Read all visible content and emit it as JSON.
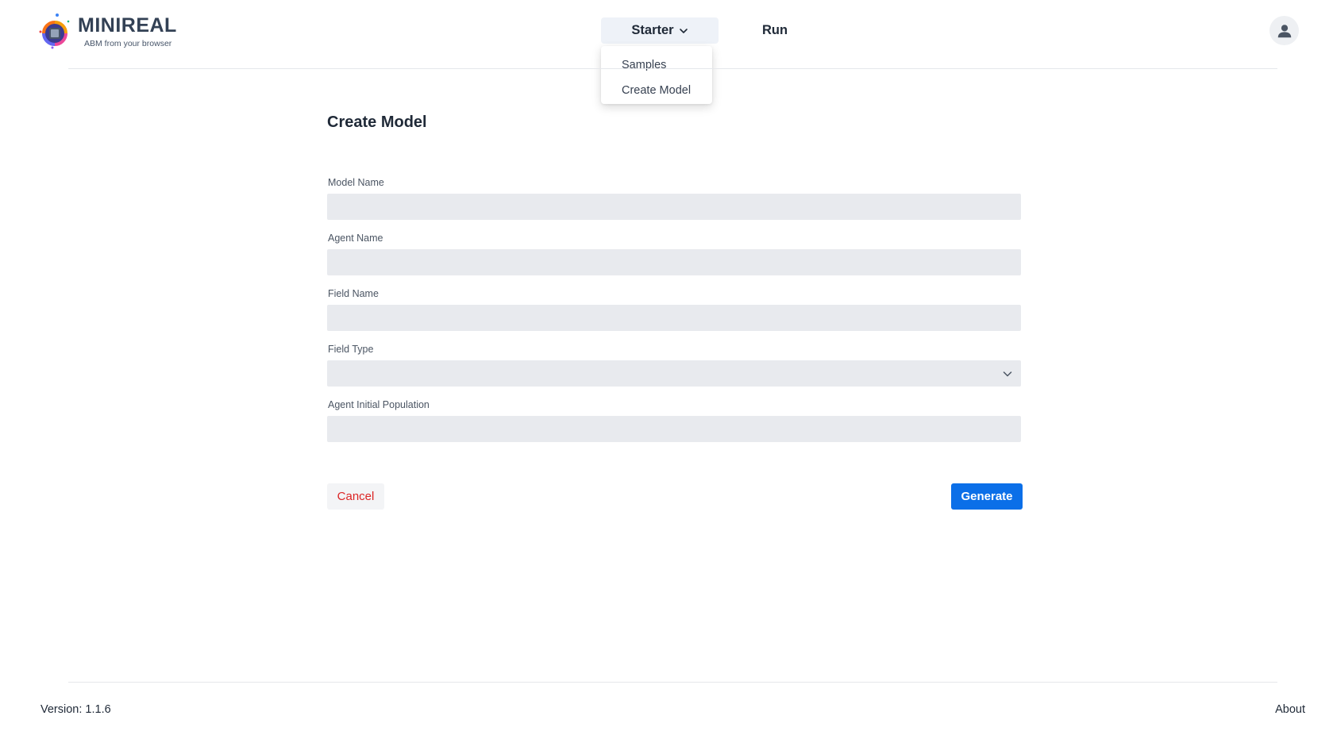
{
  "brand": {
    "title": "MINIREAL",
    "subtitle": "ABM from your browser",
    "logo_icon": "minireal-logo"
  },
  "nav": {
    "starter_label": "Starter",
    "starter_icon": "chevron-down-icon",
    "run_label": "Run",
    "dropdown_items": [
      {
        "label": "Samples"
      },
      {
        "label": "Create Model"
      }
    ],
    "user_icon": "user-icon"
  },
  "form": {
    "title": "Create Model",
    "fields": [
      {
        "label": "Model Name",
        "value": "",
        "placeholder": ""
      },
      {
        "label": "Agent Name",
        "value": "",
        "placeholder": ""
      },
      {
        "label": "Field Name",
        "value": "",
        "placeholder": ""
      },
      {
        "label": "Field Type",
        "value": "",
        "placeholder": ""
      },
      {
        "label": "Agent Initial Population",
        "value": "",
        "placeholder": ""
      }
    ],
    "cancel_label": "Cancel",
    "generate_label": "Generate"
  },
  "footer": {
    "version": "Version: 1.1.6",
    "about_label": "About"
  },
  "colors": {
    "primary": "#0b6fe8",
    "danger": "#dc2626",
    "input_bg": "#e8eaee",
    "nav_active_bg": "#eef2f8"
  }
}
